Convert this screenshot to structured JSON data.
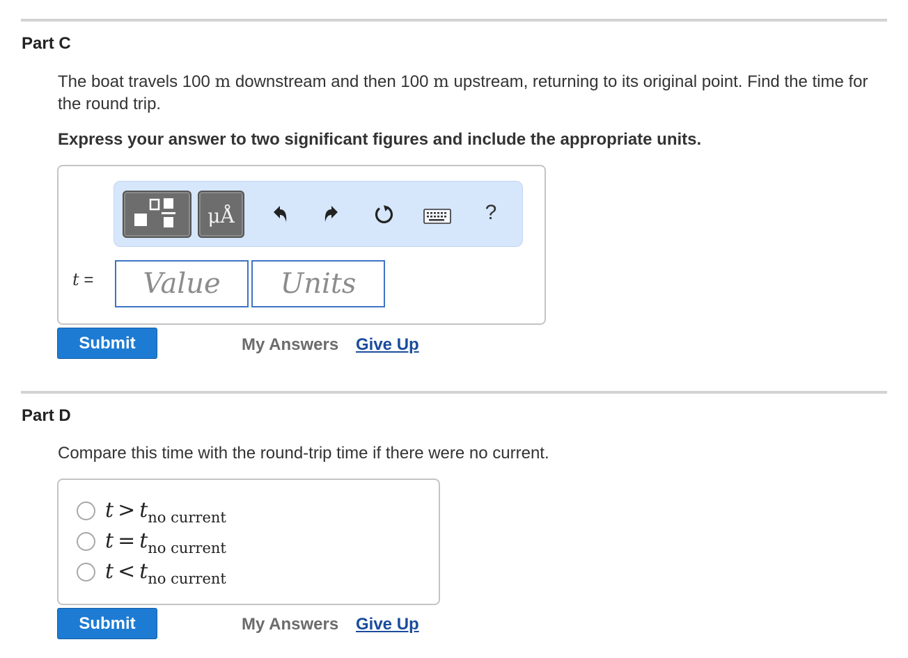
{
  "part_c": {
    "title": "Part C",
    "question": {
      "pre": "The boat travels 100 ",
      "unit1": "m",
      "mid": " downstream and then 100 ",
      "unit2": "m",
      "post": " upstream, returning to its original point. Find the time for the round trip."
    },
    "instruction": "Express your answer to two significant figures and include the appropriate units.",
    "toolbar": {
      "templates_icon": "fraction-template-icon",
      "units_symbol": "μÅ",
      "undo_icon": "undo-arrow-icon",
      "redo_icon": "redo-arrow-icon",
      "reset_icon": "reset-icon",
      "keyboard_icon": "keyboard-icon",
      "help_label": "?"
    },
    "variable": "t",
    "equals": " =",
    "value_placeholder": "Value",
    "units_placeholder": "Units",
    "submit_label": "Submit",
    "my_answers_label": "My Answers",
    "give_up_label": "Give Up"
  },
  "part_d": {
    "title": "Part D",
    "question": "Compare this time with the round-trip time if there were no current.",
    "options": [
      {
        "var": "t",
        "relation": ">",
        "rhs": "t",
        "sub": "no current"
      },
      {
        "var": "t",
        "relation": "=",
        "rhs": "t",
        "sub": "no current"
      },
      {
        "var": "t",
        "relation": "<",
        "rhs": "t",
        "sub": "no current"
      }
    ],
    "submit_label": "Submit",
    "my_answers_label": "My Answers",
    "give_up_label": "Give Up"
  },
  "colors": {
    "submit_blue": "#1d7bd3",
    "input_border": "#3d73c6",
    "toolbar_bg": "#d6e6fb",
    "link_blue": "#1a4c9c"
  }
}
